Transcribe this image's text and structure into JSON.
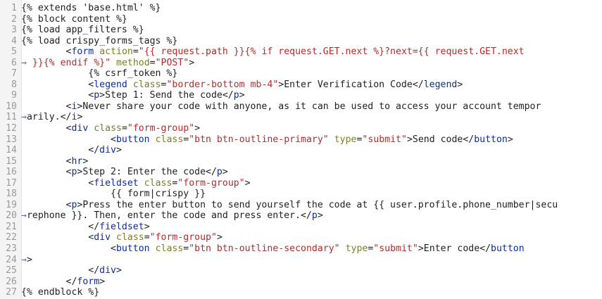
{
  "editor": {
    "lines": [
      {
        "num": "1",
        "segments": [
          [
            "tmpl",
            "{% extends 'base.html' %}"
          ]
        ]
      },
      {
        "num": "2",
        "segments": [
          [
            "tmpl",
            "{% block content %}"
          ]
        ]
      },
      {
        "num": "3",
        "segments": [
          [
            "tmpl",
            "{% load app_filters %}"
          ]
        ]
      },
      {
        "num": "4",
        "segments": [
          [
            "tmpl",
            "{% load crispy_forms_tags %}"
          ]
        ]
      },
      {
        "num": "5",
        "segments": [
          [
            "plain",
            "        <"
          ],
          [
            "tag",
            "form"
          ],
          [
            "plain",
            " "
          ],
          [
            "attr",
            "action"
          ],
          [
            "plain",
            "="
          ],
          [
            "str",
            "\"{{ request.path }}{% if request.GET.next %}?next={{ request.GET.next"
          ]
        ]
      },
      {
        "num": "6",
        "segments": [
          [
            "wrap-mark",
            "→"
          ],
          [
            "str",
            " }}{% endif %}\""
          ],
          [
            "plain",
            " "
          ],
          [
            "attr",
            "method"
          ],
          [
            "plain",
            "="
          ],
          [
            "str",
            "\"POST\""
          ],
          [
            "plain",
            ">"
          ]
        ]
      },
      {
        "num": "7",
        "segments": [
          [
            "tmpl",
            "            {% csrf_token %}"
          ]
        ]
      },
      {
        "num": "8",
        "segments": [
          [
            "plain",
            "            <"
          ],
          [
            "tag",
            "legend"
          ],
          [
            "plain",
            " "
          ],
          [
            "attr",
            "class"
          ],
          [
            "plain",
            "="
          ],
          [
            "str",
            "\"border-bottom mb-4\""
          ],
          [
            "plain",
            ">Enter Verification Code</"
          ],
          [
            "tag",
            "legend"
          ],
          [
            "plain",
            ">"
          ]
        ]
      },
      {
        "num": "9",
        "segments": [
          [
            "plain",
            "            <"
          ],
          [
            "tag",
            "p"
          ],
          [
            "plain",
            ">Step 1: Send the code</"
          ],
          [
            "tag",
            "p"
          ],
          [
            "plain",
            ">"
          ]
        ]
      },
      {
        "num": "10",
        "segments": [
          [
            "plain",
            "        <"
          ],
          [
            "tag",
            "i"
          ],
          [
            "plain",
            ">Never share your code with anyone, as it can be used to access your account tempor"
          ]
        ]
      },
      {
        "num": "11",
        "segments": [
          [
            "wrap-mark",
            "→"
          ],
          [
            "plain",
            "arily.</"
          ],
          [
            "tag",
            "i"
          ],
          [
            "plain",
            ">"
          ]
        ]
      },
      {
        "num": "12",
        "segments": [
          [
            "plain",
            "        <"
          ],
          [
            "tag",
            "div"
          ],
          [
            "plain",
            " "
          ],
          [
            "attr",
            "class"
          ],
          [
            "plain",
            "="
          ],
          [
            "str",
            "\"form-group\""
          ],
          [
            "plain",
            ">"
          ]
        ]
      },
      {
        "num": "13",
        "segments": [
          [
            "plain",
            "                <"
          ],
          [
            "tag",
            "button"
          ],
          [
            "plain",
            " "
          ],
          [
            "attr",
            "class"
          ],
          [
            "plain",
            "="
          ],
          [
            "str",
            "\"btn btn-outline-primary\""
          ],
          [
            "plain",
            " "
          ],
          [
            "attr",
            "type"
          ],
          [
            "plain",
            "="
          ],
          [
            "str",
            "\"submit\""
          ],
          [
            "plain",
            ">Send code</"
          ],
          [
            "tag",
            "button"
          ],
          [
            "plain",
            ">"
          ]
        ]
      },
      {
        "num": "14",
        "segments": [
          [
            "plain",
            "            </"
          ],
          [
            "tag",
            "div"
          ],
          [
            "plain",
            ">"
          ]
        ]
      },
      {
        "num": "15",
        "segments": [
          [
            "plain",
            "        <"
          ],
          [
            "tag",
            "hr"
          ],
          [
            "plain",
            ">"
          ]
        ]
      },
      {
        "num": "16",
        "segments": [
          [
            "plain",
            "        <"
          ],
          [
            "tag",
            "p"
          ],
          [
            "plain",
            ">Step 2: Enter the code</"
          ],
          [
            "tag",
            "p"
          ],
          [
            "plain",
            ">"
          ]
        ]
      },
      {
        "num": "17",
        "segments": [
          [
            "plain",
            "            <"
          ],
          [
            "tag",
            "fieldset"
          ],
          [
            "plain",
            " "
          ],
          [
            "attr",
            "class"
          ],
          [
            "plain",
            "="
          ],
          [
            "str",
            "\"form-group\""
          ],
          [
            "plain",
            ">"
          ]
        ]
      },
      {
        "num": "18",
        "segments": [
          [
            "tmpl",
            "                {{ form|crispy }}"
          ]
        ]
      },
      {
        "num": "19",
        "segments": [
          [
            "plain",
            "        <"
          ],
          [
            "tag",
            "p"
          ],
          [
            "plain",
            ">Press the enter button to send yourself the code at {{ user.profile.phone_number|secu"
          ]
        ]
      },
      {
        "num": "20",
        "segments": [
          [
            "wrap-mark",
            "→"
          ],
          [
            "plain",
            "rephone }}. Then, enter the code and press enter.</"
          ],
          [
            "tag",
            "p"
          ],
          [
            "plain",
            ">"
          ]
        ]
      },
      {
        "num": "21",
        "segments": [
          [
            "plain",
            "            </"
          ],
          [
            "tag",
            "fieldset"
          ],
          [
            "plain",
            ">"
          ]
        ]
      },
      {
        "num": "22",
        "segments": [
          [
            "plain",
            "            <"
          ],
          [
            "tag",
            "div"
          ],
          [
            "plain",
            " "
          ],
          [
            "attr",
            "class"
          ],
          [
            "plain",
            "="
          ],
          [
            "str",
            "\"form-group\""
          ],
          [
            "plain",
            ">"
          ]
        ]
      },
      {
        "num": "23",
        "segments": [
          [
            "plain",
            "                <"
          ],
          [
            "tag",
            "button"
          ],
          [
            "plain",
            " "
          ],
          [
            "attr",
            "class"
          ],
          [
            "plain",
            "="
          ],
          [
            "str",
            "\"btn btn-outline-secondary\""
          ],
          [
            "plain",
            " "
          ],
          [
            "attr",
            "type"
          ],
          [
            "plain",
            "="
          ],
          [
            "str",
            "\"submit\""
          ],
          [
            "plain",
            ">Enter code</"
          ],
          [
            "tag",
            "button"
          ]
        ]
      },
      {
        "num": "24",
        "segments": [
          [
            "wrap-mark",
            "→"
          ],
          [
            "plain",
            ">"
          ]
        ]
      },
      {
        "num": "25",
        "segments": [
          [
            "plain",
            "            </"
          ],
          [
            "tag",
            "div"
          ],
          [
            "plain",
            ">"
          ]
        ]
      },
      {
        "num": "26",
        "segments": [
          [
            "plain",
            "        </"
          ],
          [
            "tag",
            "form"
          ],
          [
            "plain",
            ">"
          ]
        ]
      },
      {
        "num": "27",
        "segments": [
          [
            "tmpl",
            "{% endblock %}"
          ]
        ]
      }
    ]
  }
}
